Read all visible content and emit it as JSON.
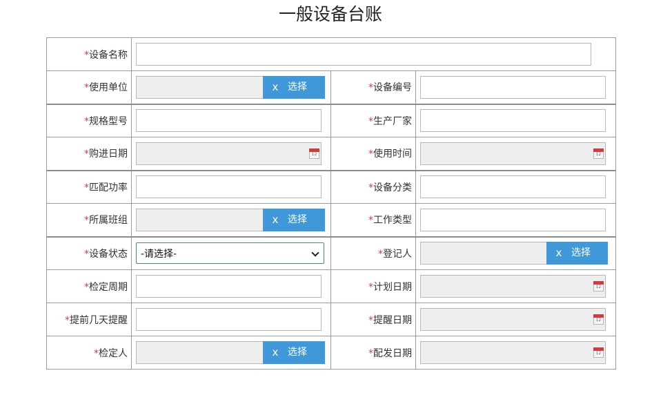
{
  "title": "一般设备台账",
  "required_mark": "*",
  "buttons": {
    "clear": "x",
    "select": "选择"
  },
  "select_placeholder": "-请选择-",
  "calendar_icon_text": "12",
  "colors": {
    "button_blue": "#3f98d8",
    "required_red": "#e4393c",
    "readonly_bg": "#eeeeee"
  },
  "fields": {
    "device_name": "设备名称",
    "using_unit": "使用单位",
    "device_code": "设备编号",
    "spec_model": "规格型号",
    "manufacturer": "生产厂家",
    "purchase_date": "购进日期",
    "usage_time": "使用时间",
    "matched_power": "匹配功率",
    "device_category": "设备分类",
    "team": "所属班组",
    "work_type": "工作类型",
    "device_status": "设备状态",
    "registrant": "登记人",
    "inspection_cycle": "检定周期",
    "plan_date": "计划日期",
    "remind_days_ahead": "提前几天提醒",
    "remind_date": "提醒日期",
    "inspector": "检定人",
    "issue_date": "配发日期"
  }
}
